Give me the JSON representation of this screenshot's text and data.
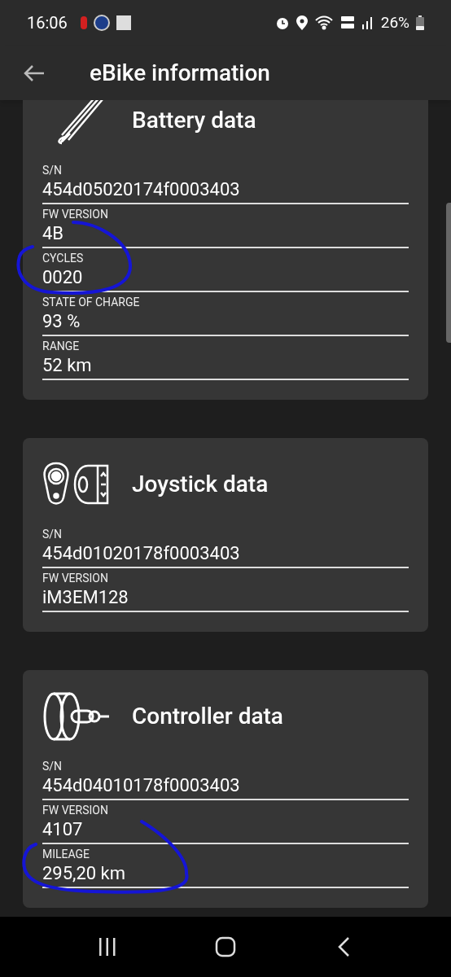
{
  "status_bar": {
    "time": "16:06",
    "battery": "26%"
  },
  "app_bar": {
    "title": "eBike information"
  },
  "cards": [
    {
      "kind": "battery",
      "title": "Battery data",
      "fields": [
        {
          "label": "S/N",
          "value": "454d05020174f0003403",
          "circled": false
        },
        {
          "label": "FW VERSION",
          "value": "4B",
          "circled": false
        },
        {
          "label": "CYCLES",
          "value": "0020",
          "circled": true
        },
        {
          "label": "STATE OF CHARGE",
          "value": "93 %",
          "circled": false
        },
        {
          "label": "RANGE",
          "value": "52 km",
          "circled": false
        }
      ]
    },
    {
      "kind": "joystick",
      "title": "Joystick data",
      "fields": [
        {
          "label": "S/N",
          "value": "454d01020178f0003403",
          "circled": false
        },
        {
          "label": "FW VERSION",
          "value": "iM3EM128",
          "circled": false
        }
      ]
    },
    {
      "kind": "motor",
      "title": "Controller data",
      "fields": [
        {
          "label": "S/N",
          "value": "454d04010178f0003403",
          "circled": false
        },
        {
          "label": "FW VERSION",
          "value": "4107",
          "circled": false
        },
        {
          "label": "MILEAGE",
          "value": "295,20 km",
          "circled": true
        }
      ]
    }
  ]
}
